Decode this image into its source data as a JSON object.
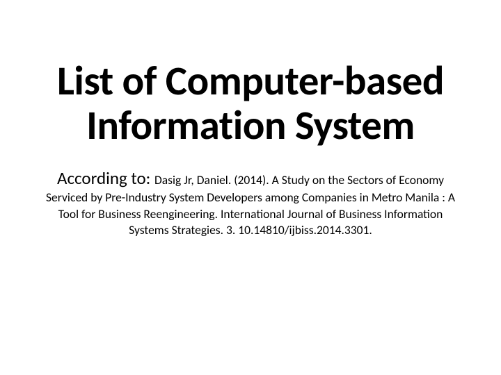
{
  "title": "List of Computer-based Information System",
  "subtitle_lead": "According to: ",
  "subtitle_body": "Dasig Jr, Daniel. (2014). A Study on the Sectors of Economy Serviced by Pre-Industry System Developers among Companies in Metro Manila : A Tool for Business Reengineering. International Journal of Business Information Systems Strategies. 3. 10.14810/ijbiss.2014.3301."
}
